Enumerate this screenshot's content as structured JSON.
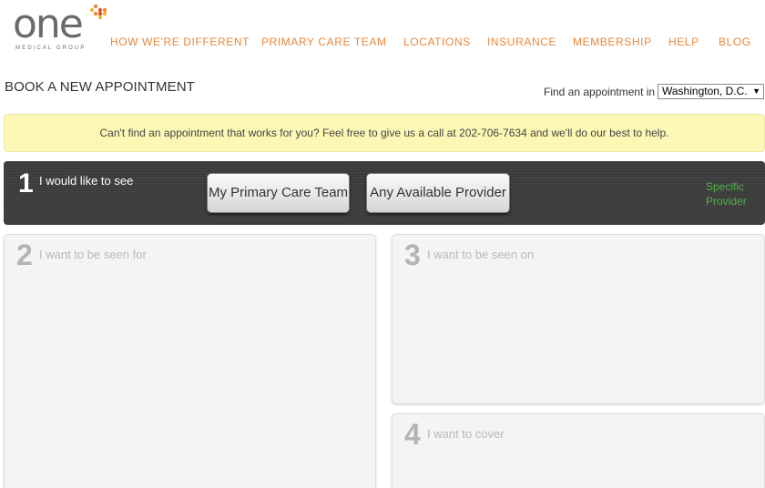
{
  "brand": {
    "logo_word": "one",
    "logo_sub": "MEDICAL GROUP",
    "dot_colors": [
      "#e8873a",
      "#e05a2b",
      "#f2b134",
      "#d94a22"
    ]
  },
  "nav": {
    "items": [
      "HOW WE'RE DIFFERENT",
      "PRIMARY CARE TEAM",
      "LOCATIONS",
      "INSURANCE",
      "MEMBERSHIP",
      "HELP",
      "BLOG"
    ],
    "color": "#e8873a"
  },
  "page_title": "BOOK A NEW APPOINTMENT",
  "location": {
    "label": "Find an appointment in",
    "selected": "Washington, D.C."
  },
  "notice": "Can't find an appointment that works for you? Feel free to give us a call at 202-706-7634 and we'll do our best to help.",
  "step1": {
    "number": "1",
    "label": "I would like to see",
    "button_primary": "My Primary Care Team",
    "button_any": "Any Available Provider",
    "specific": "Specific Provider"
  },
  "step2": {
    "number": "2",
    "label": "I want to be seen for"
  },
  "step3": {
    "number": "3",
    "label": "I want to be seen on"
  },
  "step4": {
    "number": "4",
    "label": "I want to cover"
  }
}
